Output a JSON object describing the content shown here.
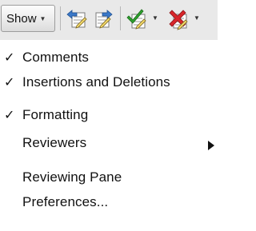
{
  "toolbar": {
    "show_label": "Show",
    "icons": [
      "previous-change-icon",
      "next-change-icon",
      "accept-change-icon",
      "reject-change-icon"
    ],
    "colors": {
      "arrow_blue": "#3a78c8",
      "accept_green": "#2ea12e",
      "reject_red": "#d8262b",
      "page_yellow": "#f2d86a"
    }
  },
  "menu": {
    "check_glyph": "✓",
    "items": [
      {
        "label": "Comments",
        "checked": true
      },
      {
        "label": "Insertions and Deletions",
        "checked": true
      },
      {
        "label": "Formatting",
        "checked": true
      },
      {
        "label": "Reviewers",
        "checked": false,
        "submenu": true
      },
      {
        "label": "Reviewing Pane",
        "checked": false
      },
      {
        "label": "Preferences...",
        "checked": false
      }
    ]
  }
}
